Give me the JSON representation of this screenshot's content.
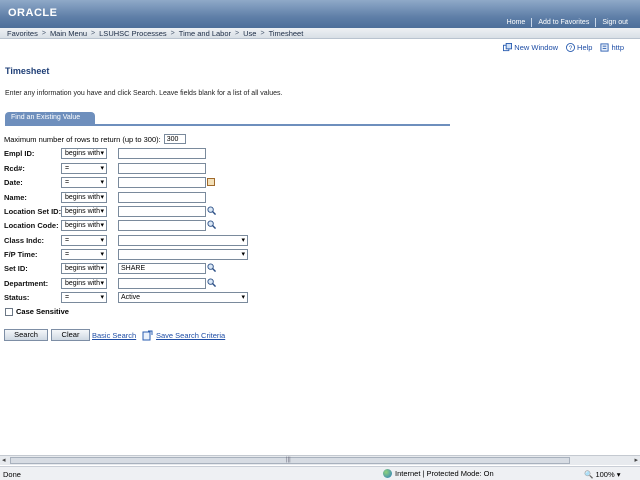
{
  "banner": {
    "logo": "ORACLE",
    "links": [
      "Home",
      "Add to Favorites",
      "Sign out"
    ]
  },
  "breadcrumb": {
    "items": [
      "Favorites",
      "Main Menu",
      "LSUHSC Processes",
      "Time and Labor",
      "Use",
      "Timesheet"
    ],
    "separator": ">"
  },
  "tools": {
    "new_window": "New Window",
    "help": "Help",
    "http": "http"
  },
  "page": {
    "title": "Timesheet",
    "instructions": "Enter any information you have and click Search. Leave fields blank for a list of all values."
  },
  "tab": {
    "label": "Find an Existing Value"
  },
  "maxrows": {
    "label": "Maximum number of rows to return (up to 300):",
    "value": "300"
  },
  "form": {
    "rows": [
      {
        "label": "Empl ID:",
        "operator": "begins with",
        "value": ""
      },
      {
        "label": "Rcd#:",
        "operator": "=",
        "value": ""
      },
      {
        "label": "Date:",
        "operator": "=",
        "value": ""
      },
      {
        "label": "Name:",
        "operator": "begins with",
        "value": ""
      },
      {
        "label": "Location Set ID:",
        "operator": "begins with",
        "value": ""
      },
      {
        "label": "Location Code:",
        "operator": "begins with",
        "value": ""
      },
      {
        "label": "Class Indc:",
        "operator": "=",
        "value": ""
      },
      {
        "label": "F/P Time:",
        "operator": "=",
        "value": ""
      },
      {
        "label": "Set ID:",
        "operator": "begins with",
        "value": "SHARE"
      },
      {
        "label": "Department:",
        "operator": "begins with",
        "value": ""
      },
      {
        "label": "Status:",
        "operator": "=",
        "value": "Active"
      }
    ]
  },
  "case_sensitive": {
    "label": "Case Sensitive",
    "checked": false
  },
  "buttons": {
    "search": "Search",
    "clear": "Clear",
    "basic_search": "Basic Search",
    "save_criteria": "Save Search Criteria"
  },
  "statusbar": {
    "left": "Done",
    "zone": "Internet | Protected Mode: On",
    "zoom": "100%"
  },
  "colors": {
    "banner": "#5f7fa8",
    "tab": "#6e8fbd",
    "title": "#1f3f77",
    "link": "#1f4ea6"
  }
}
